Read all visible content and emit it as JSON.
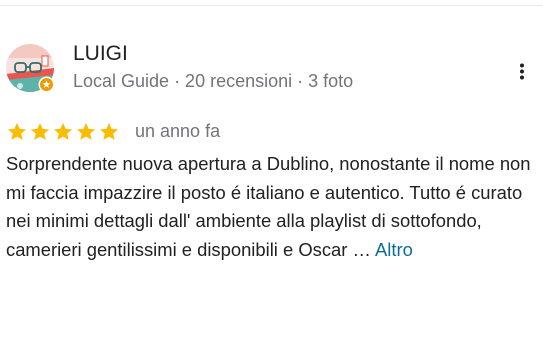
{
  "review": {
    "author": {
      "name": "LUIGI",
      "meta": "Local Guide · 20 recensioni · 3 foto",
      "avatar_icon": "illustrated-avatar-icon",
      "badge_icon": "local-guide-badge-icon"
    },
    "menu_icon": "more-vert-icon",
    "rating": 5,
    "rating_max": 5,
    "date": "un anno fa",
    "text": "Sorprendente nuova apertura a Dublino, nonostante il nome non mi faccia impazzire il posto é italiano e autentico. Tutto é curato nei minimi dettagli dall' ambiente alla playlist di sottofondo, camerieri gentilissimi e disponibili e Oscar …",
    "more_label": "Altro"
  },
  "colors": {
    "star": "#fbbc04",
    "meta_text": "#70757a",
    "link": "#0b6e99",
    "text": "#202124"
  }
}
